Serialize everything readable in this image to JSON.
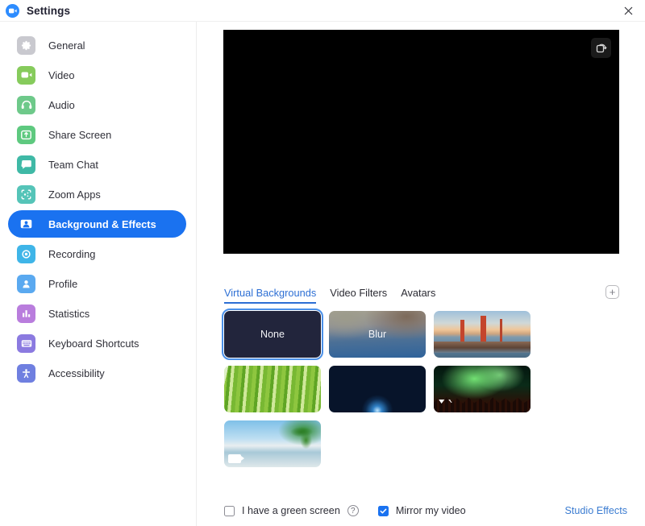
{
  "window": {
    "title": "Settings",
    "logo_icon": "zoom-video-logo",
    "close_icon": "close-icon"
  },
  "sidebar": {
    "items": [
      {
        "label": "General",
        "icon": "gear-icon",
        "color": "#c9c9cf",
        "active": false
      },
      {
        "label": "Video",
        "icon": "video-icon",
        "color": "#86cb5c",
        "active": false
      },
      {
        "label": "Audio",
        "icon": "headset-icon",
        "color": "#6ec98a",
        "active": false
      },
      {
        "label": "Share Screen",
        "icon": "upload-icon",
        "color": "#5ec97f",
        "active": false
      },
      {
        "label": "Team Chat",
        "icon": "chat-icon",
        "color": "#3fb9a6",
        "active": false
      },
      {
        "label": "Zoom Apps",
        "icon": "apps-icon",
        "color": "#55c4b8",
        "active": false
      },
      {
        "label": "Background & Effects",
        "icon": "person-card-icon",
        "color": "#1a72f0",
        "active": true
      },
      {
        "label": "Recording",
        "icon": "record-icon",
        "color": "#3fb5e8",
        "active": false
      },
      {
        "label": "Profile",
        "icon": "profile-icon",
        "color": "#5aa9f0",
        "active": false
      },
      {
        "label": "Statistics",
        "icon": "bar-chart-icon",
        "color": "#b97ddd",
        "active": false
      },
      {
        "label": "Keyboard Shortcuts",
        "icon": "keyboard-icon",
        "color": "#8b7ae0",
        "active": false
      },
      {
        "label": "Accessibility",
        "icon": "accessibility-icon",
        "color": "#6f7fe0",
        "active": false
      }
    ]
  },
  "preview": {
    "popout_icon": "pop-out-icon",
    "background": "#000000"
  },
  "tabs": [
    {
      "label": "Virtual Backgrounds",
      "active": true
    },
    {
      "label": "Video Filters",
      "active": false
    },
    {
      "label": "Avatars",
      "active": false
    }
  ],
  "add_button": {
    "icon": "plus-icon",
    "label": "+"
  },
  "backgrounds": [
    {
      "label": "None",
      "art": "art-none",
      "selected": true,
      "video": false
    },
    {
      "label": "Blur",
      "art": "art-blur",
      "selected": false,
      "video": false
    },
    {
      "label": "",
      "art": "art-bridge",
      "selected": false,
      "video": false
    },
    {
      "label": "",
      "art": "art-grass",
      "selected": false,
      "video": false
    },
    {
      "label": "",
      "art": "art-earth",
      "selected": false,
      "video": false
    },
    {
      "label": "",
      "art": "art-aurora",
      "selected": false,
      "video": true
    },
    {
      "label": "",
      "art": "art-beach",
      "selected": false,
      "video": true
    }
  ],
  "bottom": {
    "green_screen_label": "I have a green screen",
    "green_screen_checked": false,
    "help_icon": "question-mark-icon",
    "help_label": "?",
    "mirror_label": "Mirror my video",
    "mirror_checked": true,
    "studio_effects_label": "Studio Effects"
  },
  "colors": {
    "accent": "#1a72f0",
    "link": "#3b7cd1",
    "tab_active": "#2d6fd4"
  }
}
